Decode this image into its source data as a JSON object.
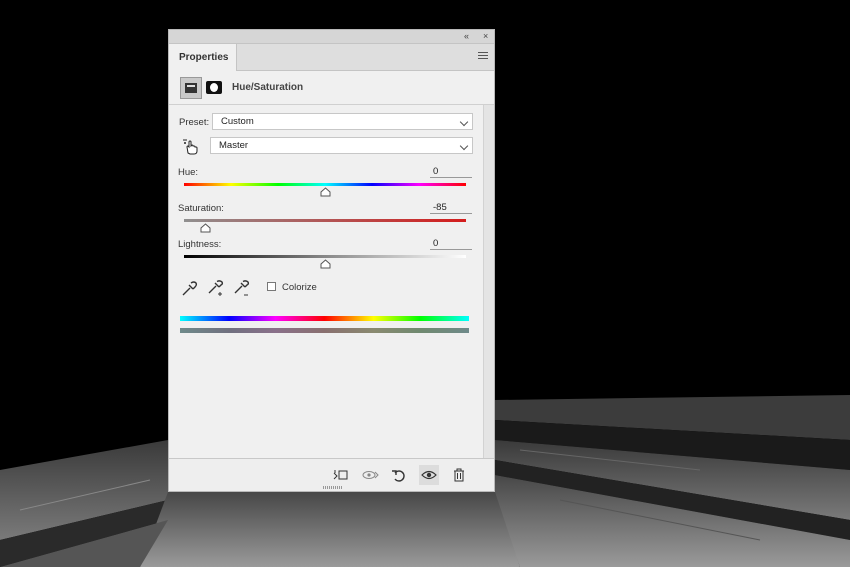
{
  "panel": {
    "top_buttons": [
      "«",
      "×"
    ],
    "tab_label": "Properties",
    "adjustment_title": "Hue/Saturation",
    "preset_label": "Preset:",
    "preset_value": "Custom",
    "channel_value": "Master",
    "hue": {
      "label": "Hue:",
      "value": "0",
      "level": 0.5
    },
    "saturation": {
      "label": "Saturation:",
      "value": "-85",
      "level": 0.075
    },
    "lightness": {
      "label": "Lightness:",
      "value": "0",
      "level": 0.5
    },
    "colorize_label": "Colorize",
    "colorize_checked": false
  },
  "icons": {
    "adjustment": "hue-saturation-icon",
    "mask": "layer-mask-icon",
    "targeted_adjust": "targeted-adjustment-hand-icon",
    "eyedroppers": [
      "eyedropper-icon",
      "eyedropper-plus-icon",
      "eyedropper-minus-icon"
    ],
    "footer": [
      "clip-to-layer-icon",
      "view-previous-state-icon",
      "reset-icon",
      "visibility-eye-icon",
      "trash-icon"
    ],
    "panel_menu": "panel-menu-icon"
  },
  "colors": {
    "panel_bg": "#f0f0f0",
    "saturation_track_start": "#909090",
    "saturation_track_end": "#d41c1c"
  }
}
